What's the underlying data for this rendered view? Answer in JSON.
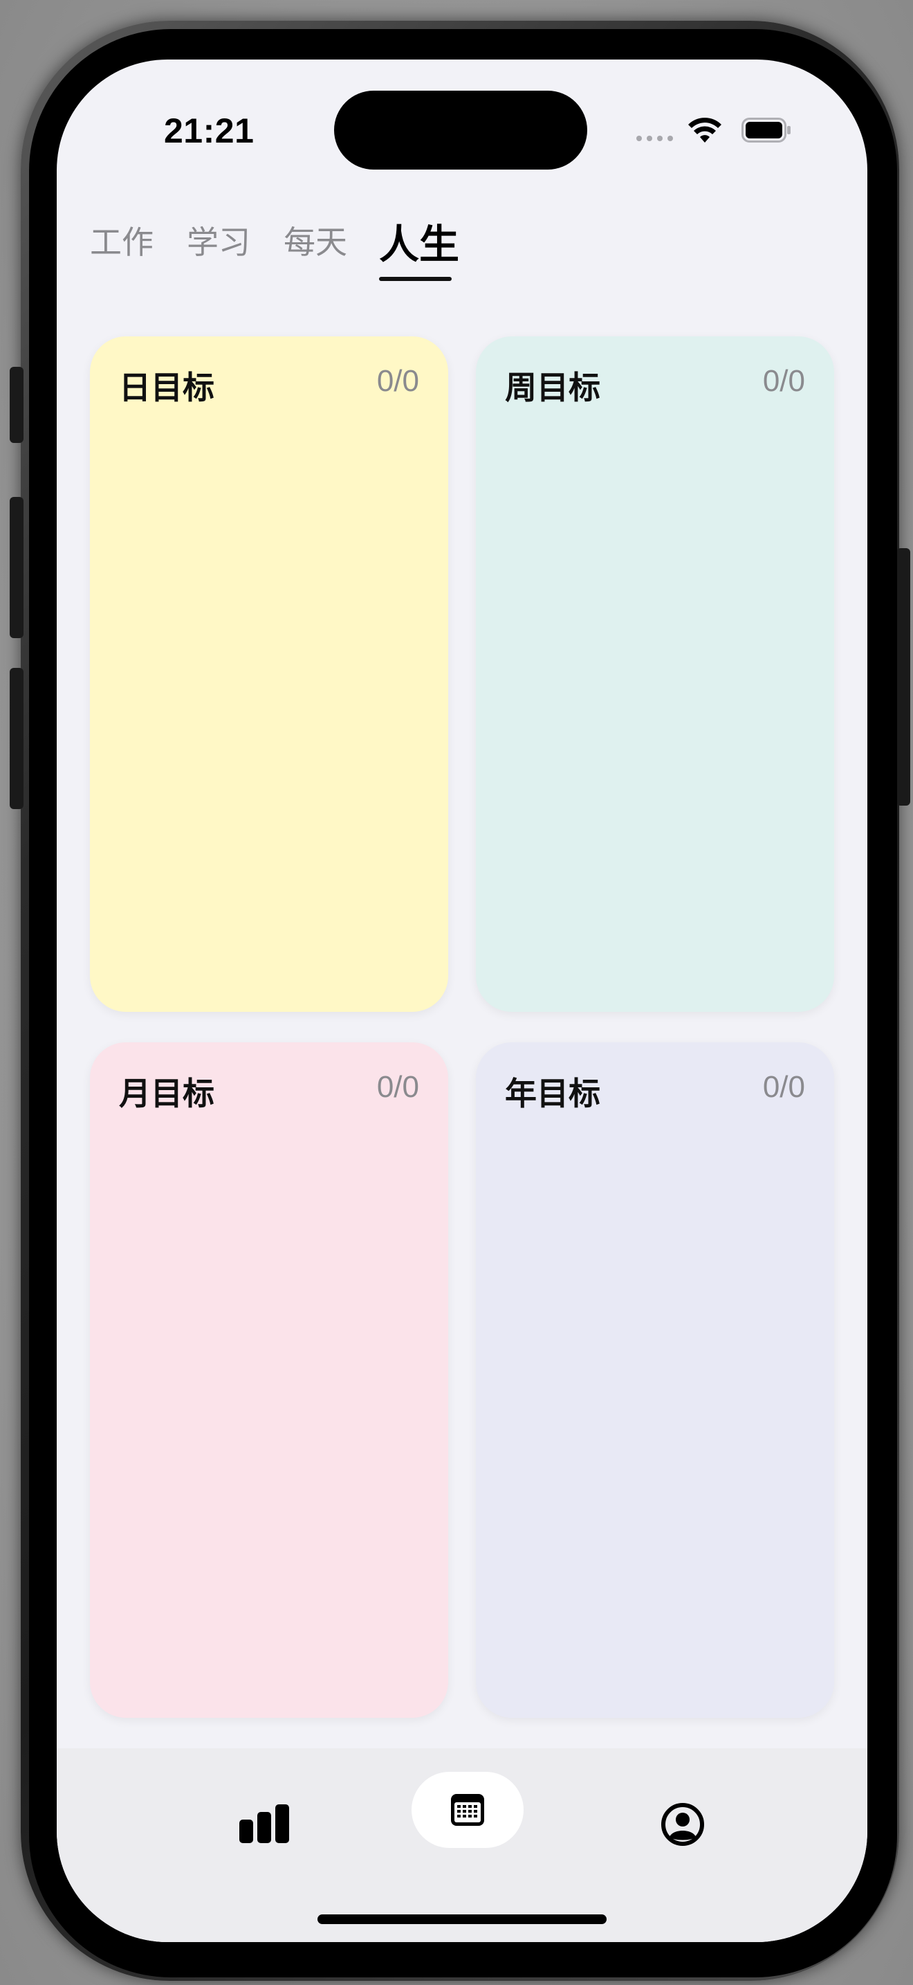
{
  "status_bar": {
    "time": "21:21",
    "icons": [
      "cellular-signal-icon",
      "wifi-icon",
      "battery-icon"
    ]
  },
  "tabs": [
    {
      "label": "工作",
      "active": false
    },
    {
      "label": "学习",
      "active": false
    },
    {
      "label": "每天",
      "active": false
    },
    {
      "label": "人生",
      "active": true
    }
  ],
  "cards": {
    "day": {
      "title": "日目标",
      "count": "0/0",
      "color": "#fff8c6"
    },
    "week": {
      "title": "周目标",
      "count": "0/0",
      "color": "#dff1ef"
    },
    "month": {
      "title": "月目标",
      "count": "0/0",
      "color": "#fbe3ea"
    },
    "year": {
      "title": "年目标",
      "count": "0/0",
      "color": "#e8e9f5"
    }
  },
  "bottom_nav": {
    "items": [
      {
        "icon": "bar-chart-icon",
        "selected": false
      },
      {
        "icon": "calendar-icon",
        "selected": true
      },
      {
        "icon": "profile-icon",
        "selected": false
      }
    ]
  },
  "colors": {
    "background": "#f2f2f7",
    "active_tab": "#000000",
    "inactive_tab": "#8a8a8e"
  }
}
